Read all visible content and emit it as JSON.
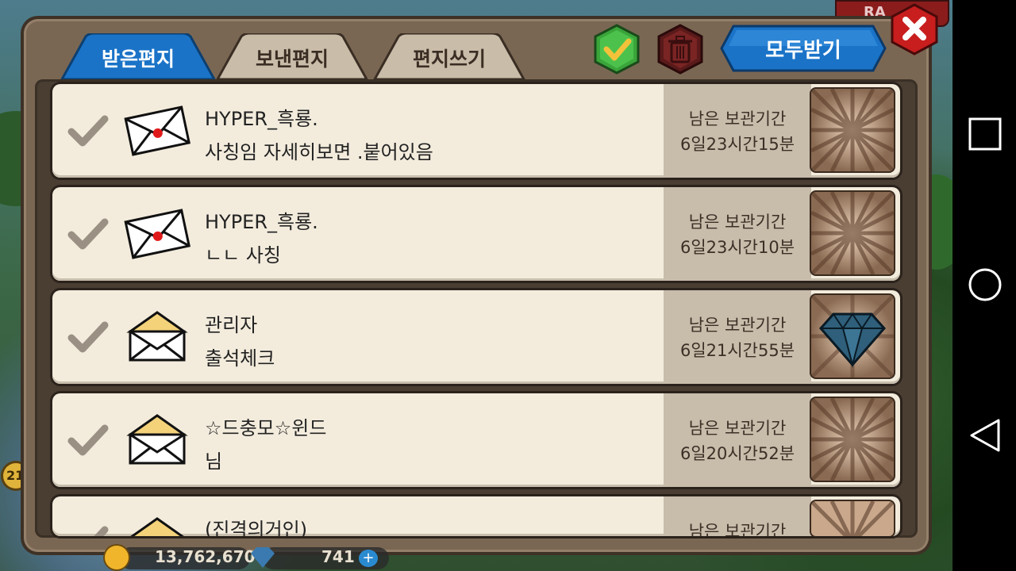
{
  "tabs": [
    {
      "label": "받은편지",
      "active": true
    },
    {
      "label": "보낸편지",
      "active": false
    },
    {
      "label": "편지쓰기",
      "active": false
    }
  ],
  "toolbar": {
    "receive_all_label": "모두받기"
  },
  "top_banner": {
    "text": "RA"
  },
  "level": "21",
  "mails": [
    {
      "sender": "HYPER_흑룡.",
      "message": "사칭임 자세히보면 .붙어있음",
      "expiry_label": "남은 보관기간",
      "expiry_time": "6일23시간15분",
      "envelope": "sealed-envelope-icon",
      "reward": "empty-reward-icon"
    },
    {
      "sender": "HYPER_흑룡.",
      "message": "ㄴㄴ 사칭",
      "expiry_label": "남은 보관기간",
      "expiry_time": "6일23시간10분",
      "envelope": "sealed-envelope-icon",
      "reward": "empty-reward-icon"
    },
    {
      "sender": "관리자",
      "message": "출석체크",
      "expiry_label": "남은 보관기간",
      "expiry_time": "6일21시간55분",
      "envelope": "open-envelope-icon",
      "reward": "diamond-icon"
    },
    {
      "sender": "☆드충모☆윈드",
      "message": "님",
      "expiry_label": "남은 보관기간",
      "expiry_time": "6일20시간52분",
      "envelope": "open-envelope-icon",
      "reward": "empty-reward-icon"
    },
    {
      "sender": "(진격의거인)",
      "message": "",
      "expiry_label": "남은 보관기간",
      "expiry_time": "",
      "envelope": "open-envelope-icon",
      "reward": "empty-reward-icon"
    }
  ],
  "status": {
    "gold": "13,762,670",
    "gems": "741"
  },
  "colors": {
    "active_tab": "#1a73c7",
    "inactive_tab": "#c9bca8",
    "panel": "#7a6753",
    "row_bg": "#f3ecdd",
    "expiry_bg": "#c8bcab"
  }
}
